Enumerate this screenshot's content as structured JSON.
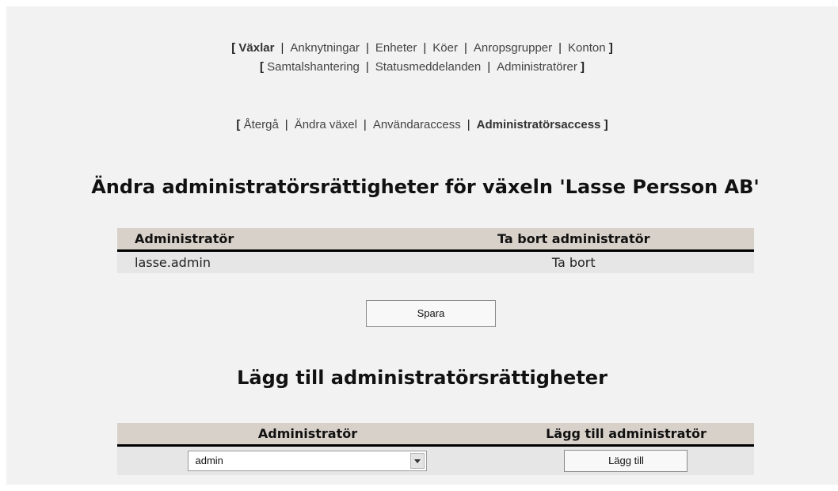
{
  "nav_primary": {
    "open_bracket": "[",
    "close_bracket": "]",
    "separator": "|",
    "row1": [
      "Växlar",
      "Anknytningar",
      "Enheter",
      "Köer",
      "Anropsgrupper",
      "Konton"
    ],
    "row2": [
      "Samtalshantering",
      "Statusmeddelanden",
      "Administratörer"
    ],
    "active": "Växlar"
  },
  "nav_secondary": {
    "items": [
      "Återgå",
      "Ändra växel",
      "Användaraccess",
      "Administratörsaccess"
    ],
    "active": "Administratörsaccess"
  },
  "page_title": "Ändra administratörsrättigheter för växeln 'Lasse Persson AB'",
  "admin_table": {
    "headers": [
      "Administratör",
      "Ta bort administratör"
    ],
    "rows": [
      {
        "name": "lasse.admin",
        "action": "Ta bort"
      }
    ]
  },
  "save_label": "Spara",
  "add_section": {
    "title": "Lägg till administratörsrättigheter",
    "headers": [
      "Administratör",
      "Lägg till administratör"
    ],
    "selected_admin": "admin",
    "add_label": "Lägg till"
  },
  "colors": {
    "page_bg": "#f2f2f2",
    "header_bg": "#d8d1c9",
    "row_bg": "#e6e6e6"
  }
}
